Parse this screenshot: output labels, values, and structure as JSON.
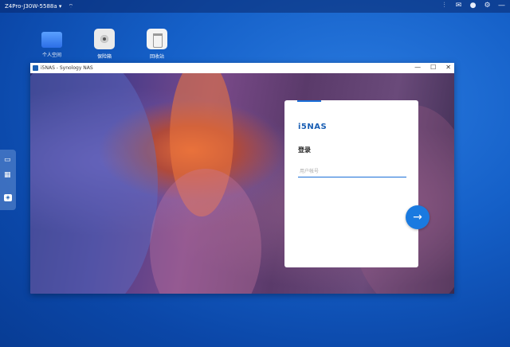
{
  "taskbar": {
    "device_name": "Z4Pro-J30W-5588a",
    "dropdown_icon": "chevron-down-icon",
    "right_icons": [
      "sliders-icon",
      "mail-icon",
      "user-icon",
      "gear-icon",
      "minus-icon"
    ]
  },
  "desktop": {
    "icons": [
      {
        "label": "个人空间",
        "icon": "folder-icon"
      },
      {
        "label": "保险箱",
        "icon": "safe-icon"
      },
      {
        "label": "回收站",
        "icon": "trash-icon"
      }
    ]
  },
  "dock": {
    "items": [
      "drive-icon",
      "apps-grid-icon",
      "nas-app-icon"
    ]
  },
  "window": {
    "title": "i5NAS - Synology NAS",
    "controls": {
      "minimize": "—",
      "maximize": "☐",
      "close": "✕"
    }
  },
  "login": {
    "brand": "i5NAS",
    "heading": "登录",
    "username_placeholder": "用户帐号",
    "username_value": "",
    "next_icon": "arrow-right-icon"
  },
  "colors": {
    "accent": "#1a7ae0",
    "desktop_bg": "#1560c8",
    "brand": "#1a5fb4"
  }
}
